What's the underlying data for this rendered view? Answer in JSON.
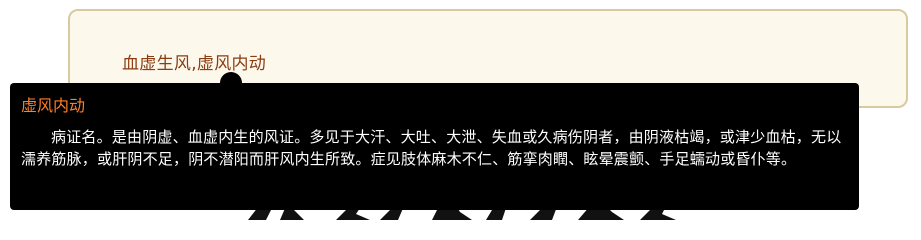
{
  "card": {
    "term_text": "血虚生风,虚风内动"
  },
  "tooltip": {
    "title": "虚风内动",
    "body": "病证名。是由阴虚、血虚内生的风证。多见于大汗、大吐、大泄、失血或久病伤阴者，由阴液枯竭，或津少血枯，无以濡养筋脉，或肝阴不足，阴不潜阳而肝风内生所致。症见肢体麻木不仁、筋挛肉瞤、眩晕震颤、手足蠕动或昏仆等。"
  },
  "colors": {
    "card_background": "#fdf8ec",
    "card_border": "#d9c9a3",
    "term_text": "#8b3c10",
    "tooltip_background": "#000000",
    "tooltip_title": "#ff7f27",
    "tooltip_text": "#ffffff"
  }
}
